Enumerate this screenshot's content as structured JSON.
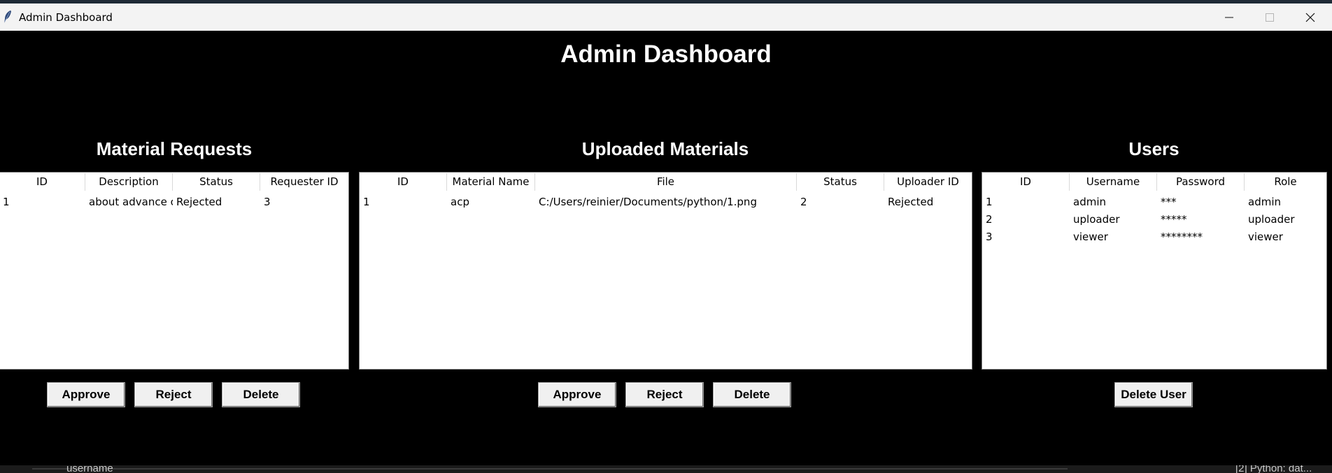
{
  "window": {
    "title": "Admin Dashboard",
    "minimize_glyph": "—",
    "maximize_glyph": "☐",
    "close_glyph": "✕"
  },
  "main_title": "Admin Dashboard",
  "material_requests": {
    "title": "Material Requests",
    "columns": [
      "ID",
      "Description",
      "Status",
      "Requester ID"
    ],
    "rows": [
      [
        "1",
        "about advance cc",
        "Rejected",
        "3"
      ]
    ],
    "buttons": {
      "approve": "Approve",
      "reject": "Reject",
      "delete": "Delete"
    }
  },
  "uploaded_materials": {
    "title": "Uploaded Materials",
    "columns": [
      "ID",
      "Material Name",
      "File",
      "Status",
      "Uploader ID"
    ],
    "rows": [
      [
        "1",
        "acp",
        "C:/Users/reinier/Documents/python/1.png",
        "2",
        "Rejected"
      ]
    ],
    "buttons": {
      "approve": "Approve",
      "reject": "Reject",
      "delete": "Delete"
    }
  },
  "users": {
    "title": "Users",
    "columns": [
      "ID",
      "Username",
      "Password",
      "Role"
    ],
    "rows": [
      [
        "1",
        "admin",
        "***",
        "admin"
      ],
      [
        "2",
        "uploader",
        "*****",
        "uploader"
      ],
      [
        "3",
        "viewer",
        "********",
        "viewer"
      ]
    ],
    "buttons": {
      "delete_user": "Delete User"
    }
  },
  "taskbar": {
    "left_text": "username",
    "right_text": "[2] Python: dat..."
  },
  "icons": {
    "app": "feather-icon"
  }
}
